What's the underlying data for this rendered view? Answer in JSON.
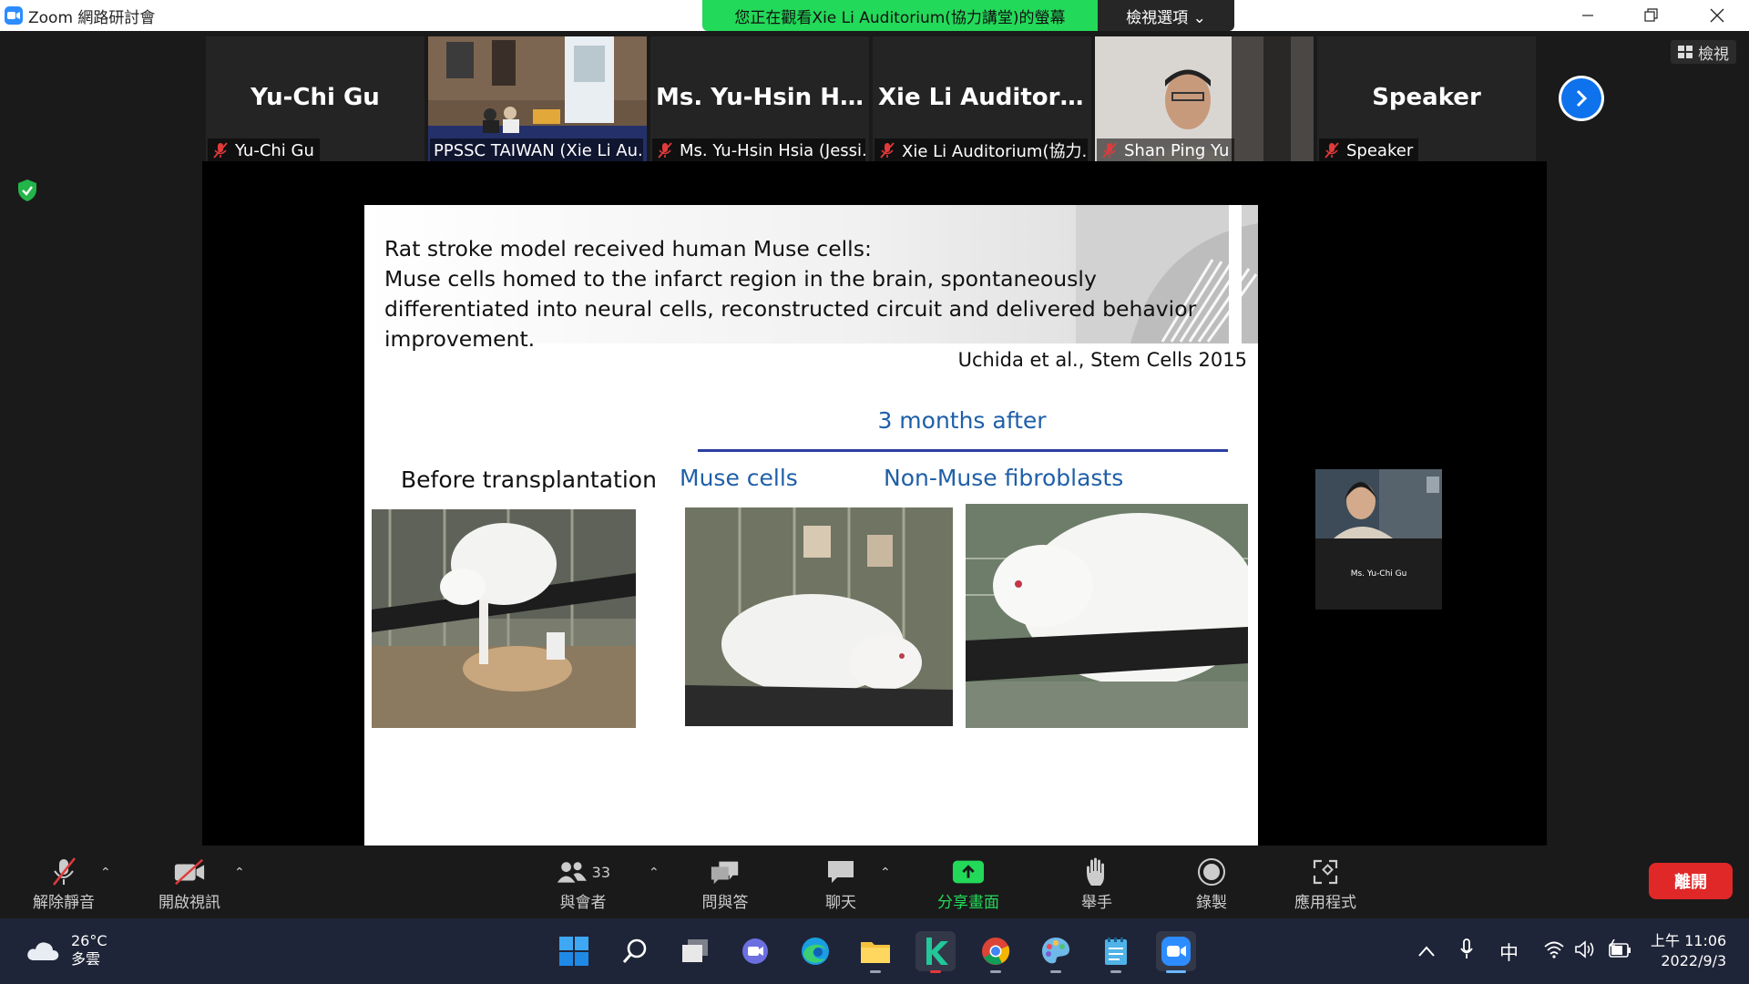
{
  "window": {
    "title": "Zoom 網路研討會"
  },
  "banner": {
    "sharing_text": "您正在觀看Xie Li Auditorium(協力講堂)的螢幕",
    "view_options": "檢視選項 ⌄"
  },
  "controls": {
    "view_label": "檢視"
  },
  "participants": [
    {
      "display_name": "Yu-Chi Gu",
      "label": "Yu-Chi Gu",
      "muted": true
    },
    {
      "display_name": "",
      "label": "PPSSC TAIWAN (Xie Li Au...",
      "muted": false,
      "active": true
    },
    {
      "display_name": "Ms. Yu-Hsin Hsi...",
      "label": "Ms. Yu-Hsin Hsia (Jessi...",
      "muted": true
    },
    {
      "display_name": "Xie Li Auditoriu...",
      "label": "Xie Li Auditorium(協力...",
      "muted": true
    },
    {
      "display_name": "",
      "label": "Shan Ping Yu",
      "muted": true
    },
    {
      "display_name": "Speaker",
      "label": "Speaker",
      "muted": true
    }
  ],
  "slide": {
    "line1": "Rat stroke model received human Muse cells:",
    "line2": "Muse cells homed to the infarct region in the brain, spontaneously differentiated into neural cells, reconstructed circuit and delivered behavior improvement.",
    "citation": "Uchida et al., Stem Cells 2015",
    "months_after": "3 months after",
    "before_caption": "Before transplantation",
    "muse_caption": "Muse cells",
    "nonmuse_caption": "Non-Muse fibroblasts"
  },
  "self_view": {
    "name": "Ms. Yu-Chi Gu"
  },
  "toolbar": {
    "unmute": "解除靜音",
    "start_video": "開啟視訊",
    "participants": "與會者",
    "participant_count": "33",
    "qa": "問與答",
    "chat": "聊天",
    "share": "分享畫面",
    "raise_hand": "舉手",
    "record": "錄製",
    "apps": "應用程式",
    "leave": "離開",
    "share_color": "#23d959",
    "leave_color": "#e02828"
  },
  "taskbar": {
    "temperature": "26°C",
    "weather": "多雲",
    "ime": "中",
    "time": "上午 11:06",
    "date": "2022/9/3"
  }
}
